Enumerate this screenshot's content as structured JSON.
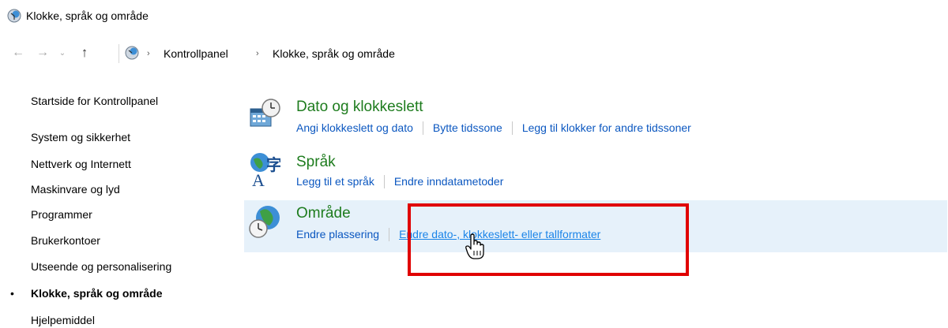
{
  "window": {
    "title": "Klokke, språk og område",
    "icon": "clock-globe-icon"
  },
  "nav": {
    "back_icon": "←",
    "forward_icon": "→",
    "recent_icon": "⌄",
    "up_icon": "↑",
    "breadcrumb": [
      "Kontrollpanel",
      "Klokke, språk og område"
    ],
    "sep": "›"
  },
  "sidebar": {
    "home": "Startside for Kontrollpanel",
    "items": [
      "System og sikkerhet",
      "Nettverk og Internett",
      "Maskinvare og lyd",
      "Programmer",
      "Brukerkontoer",
      "Utseende og personalisering",
      "Klokke, språk og område",
      "Hjelpemiddel"
    ],
    "current_bullet": "•"
  },
  "categories": [
    {
      "title": "Dato og klokkeslett",
      "icon": "calendar-clock-icon",
      "links": [
        "Angi klokkeslett og dato",
        "Bytte tidssone",
        "Legg til klokker for andre tidssoner"
      ]
    },
    {
      "title": "Språk",
      "icon": "language-icon",
      "links": [
        "Legg til et språk",
        "Endre inndatametoder"
      ]
    },
    {
      "title": "Område",
      "icon": "globe-clock-icon",
      "links": [
        "Endre plassering",
        "Endre dato-, klokkeslett- eller tallformater"
      ]
    }
  ],
  "colors": {
    "title_green": "#1e7c1e",
    "link_blue": "#0b57c0",
    "highlight": "#e6f1fa",
    "annotation_red": "#e00000"
  }
}
